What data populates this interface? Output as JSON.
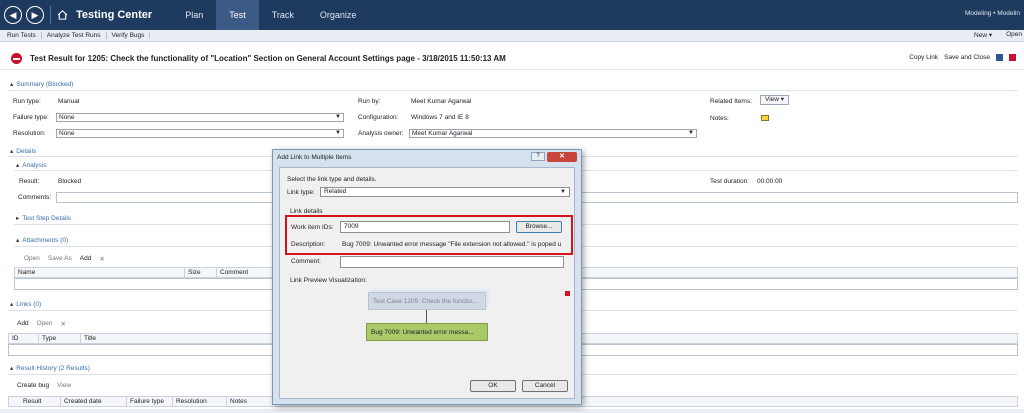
{
  "app": {
    "title": "Testing Center",
    "tabs": [
      "Plan",
      "Test",
      "Track",
      "Organize"
    ],
    "active_tab": "Test",
    "breadcrumb": "Modeling • Modelin"
  },
  "toolbar": {
    "items": [
      "Run Tests",
      "Analyze Test Runs",
      "Verify Bugs"
    ],
    "new_label": "New ▾",
    "open_label": "Open"
  },
  "result": {
    "title": "Test Result for 1205: Check the functionality of \"Location\" Section on General Account Settings page - 3/18/2015 11:50:13 AM",
    "actions": {
      "copy_link": "Copy Link",
      "save_close": "Save and Close"
    }
  },
  "summary": {
    "header": "Summary (Blocked)",
    "run_type_label": "Run type:",
    "run_type": "Manual",
    "failure_type_label": "Failure type:",
    "failure_type": "None",
    "resolution_label": "Resolution:",
    "resolution": "None",
    "run_by_label": "Run by:",
    "run_by": "Meet Kumar Agarwal",
    "configuration_label": "Configuration:",
    "configuration": "Windows 7 and IE 8",
    "analysis_owner_label": "Analysis owner:",
    "analysis_owner": "Meet Kumar Agarwal",
    "related_items_label": "Related Items:",
    "view_label": "View ▾",
    "notes_label": "Notes:"
  },
  "details": {
    "header": "Details",
    "analysis_header": "Analysis",
    "result_label": "Result:",
    "result": "Blocked",
    "comments_label": "Comments:",
    "test_duration_label": "Test duration:",
    "test_duration": "00:00:00",
    "step_details_header": "Test Step Details"
  },
  "attachments": {
    "header": "Attachments (0)",
    "tools": [
      "Open",
      "Save As",
      "Add",
      "✕"
    ],
    "columns": [
      "Name",
      "Size",
      "Comment"
    ]
  },
  "links": {
    "header": "Links (0)",
    "tools": [
      "Add",
      "Open",
      "✕"
    ],
    "columns": [
      "ID",
      "Type",
      "Title"
    ]
  },
  "history": {
    "header": "Result History (2 Results)",
    "tools": [
      "Create bug",
      "View"
    ],
    "columns": [
      "Result",
      "Created date",
      "Failure type",
      "Resolution",
      "Notes"
    ]
  },
  "dialog": {
    "title": "Add Link to Multiple Items",
    "help": "?",
    "close": "✕",
    "instruction": "Select the link type and details.",
    "link_type_label": "Link type:",
    "link_type": "Related",
    "link_details_label": "Link details",
    "work_item_ids_label": "Work item IDs:",
    "work_item_ids": "7009",
    "browse_label": "Browse...",
    "description_label": "Description:",
    "description": "Bug 7009: Unwanted error message \"File extension not allowed.\" is poped u",
    "comment_label": "Comment:",
    "preview_label": "Link Preview Visualization:",
    "preview_source": "Test Case 1205: Check the functio...",
    "preview_target": "Bug 7009: Unwanted error messa...",
    "ok_label": "OK",
    "cancel_label": "Cancel"
  },
  "colors": {
    "topbar": "#1f3a5f",
    "accent": "#3a6db0",
    "highlight": "#d4141c",
    "preview_target": "#a9c96a"
  }
}
